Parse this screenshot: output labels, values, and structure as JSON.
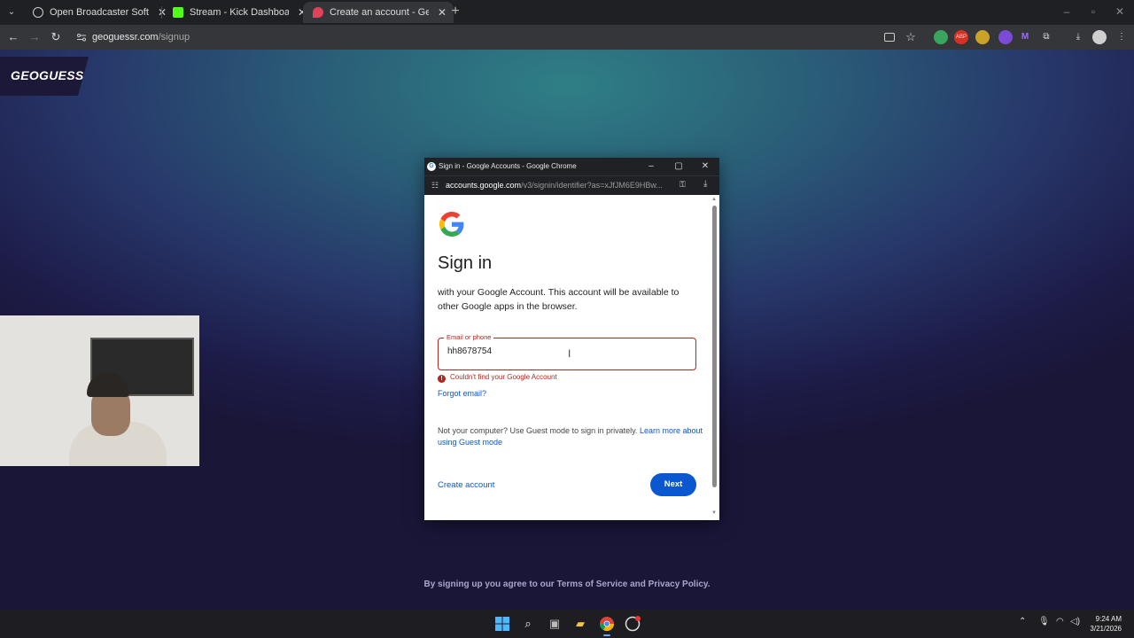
{
  "browser": {
    "tabs": [
      {
        "title": "Open Broadcaster Software | OBS",
        "favicon_color": "#cfcfcf",
        "active": false
      },
      {
        "title": "Stream - Kick Dashboard",
        "favicon_color": "#53fc18",
        "active": false
      },
      {
        "title": "Create an account - GeoGuessr",
        "favicon_color": "#e0415b",
        "active": true
      }
    ],
    "close_glyph": "✕",
    "new_tab_glyph": "+",
    "url_host": "geoguessr.com",
    "url_path": "/signup"
  },
  "page": {
    "logo_text": "GEOGUESSR",
    "terms_text": "By signing up you agree to our Terms of Service and Privacy Policy."
  },
  "popup": {
    "window_title": "Sign in - Google Accounts - Google Chrome",
    "url_host": "accounts.google.com",
    "url_path": "/v3/signin/identifier?as=xJfJM6E9HBw...",
    "heading": "Sign in",
    "subtitle": "with your Google Account. This account will be available to other Google apps in the browser.",
    "email_label": "Email or phone",
    "email_value": "hh8678754",
    "error_text": "Couldn't find your Google Account",
    "forgot_email": "Forgot email?",
    "guest_text": "Not your computer? Use Guest mode to sign in privately.",
    "guest_link": "Learn more about using Guest mode",
    "create_account": "Create account",
    "next_button": "Next"
  },
  "taskbar": {
    "time": "9:24 AM",
    "date": "3/21/2026"
  },
  "colors": {
    "error": "#b3261e",
    "link": "#0b57d0",
    "primary_button": "#0b57d0"
  }
}
